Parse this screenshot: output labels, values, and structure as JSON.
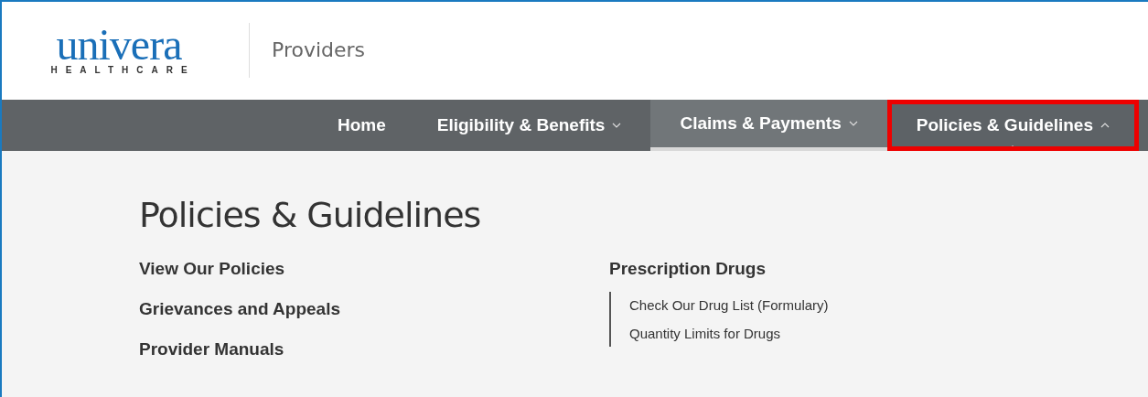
{
  "header": {
    "logo": {
      "word": "univera",
      "tagline": "HEALTHCARE"
    },
    "site_name": "Providers"
  },
  "nav": {
    "tabs": [
      {
        "label": "Home",
        "has_menu": false,
        "hover": false,
        "selected": false,
        "annotated": false
      },
      {
        "label": "Eligibility & Benefits",
        "has_menu": true,
        "hover": false,
        "selected": false,
        "annotated": false
      },
      {
        "label": "Claims & Payments",
        "has_menu": true,
        "hover": true,
        "selected": false,
        "annotated": false
      },
      {
        "label": "Policies & Guidelines",
        "has_menu": true,
        "hover": false,
        "selected": true,
        "annotated": true
      }
    ]
  },
  "menu": {
    "title": "Policies & Guidelines",
    "links": [
      "View Our Policies",
      "Grievances and Appeals",
      "Provider Manuals"
    ],
    "groups": [
      {
        "heading": "Prescription Drugs",
        "links": [
          "Check Our Drug List (Formulary)",
          "Quantity Limits for Drugs"
        ]
      }
    ]
  }
}
